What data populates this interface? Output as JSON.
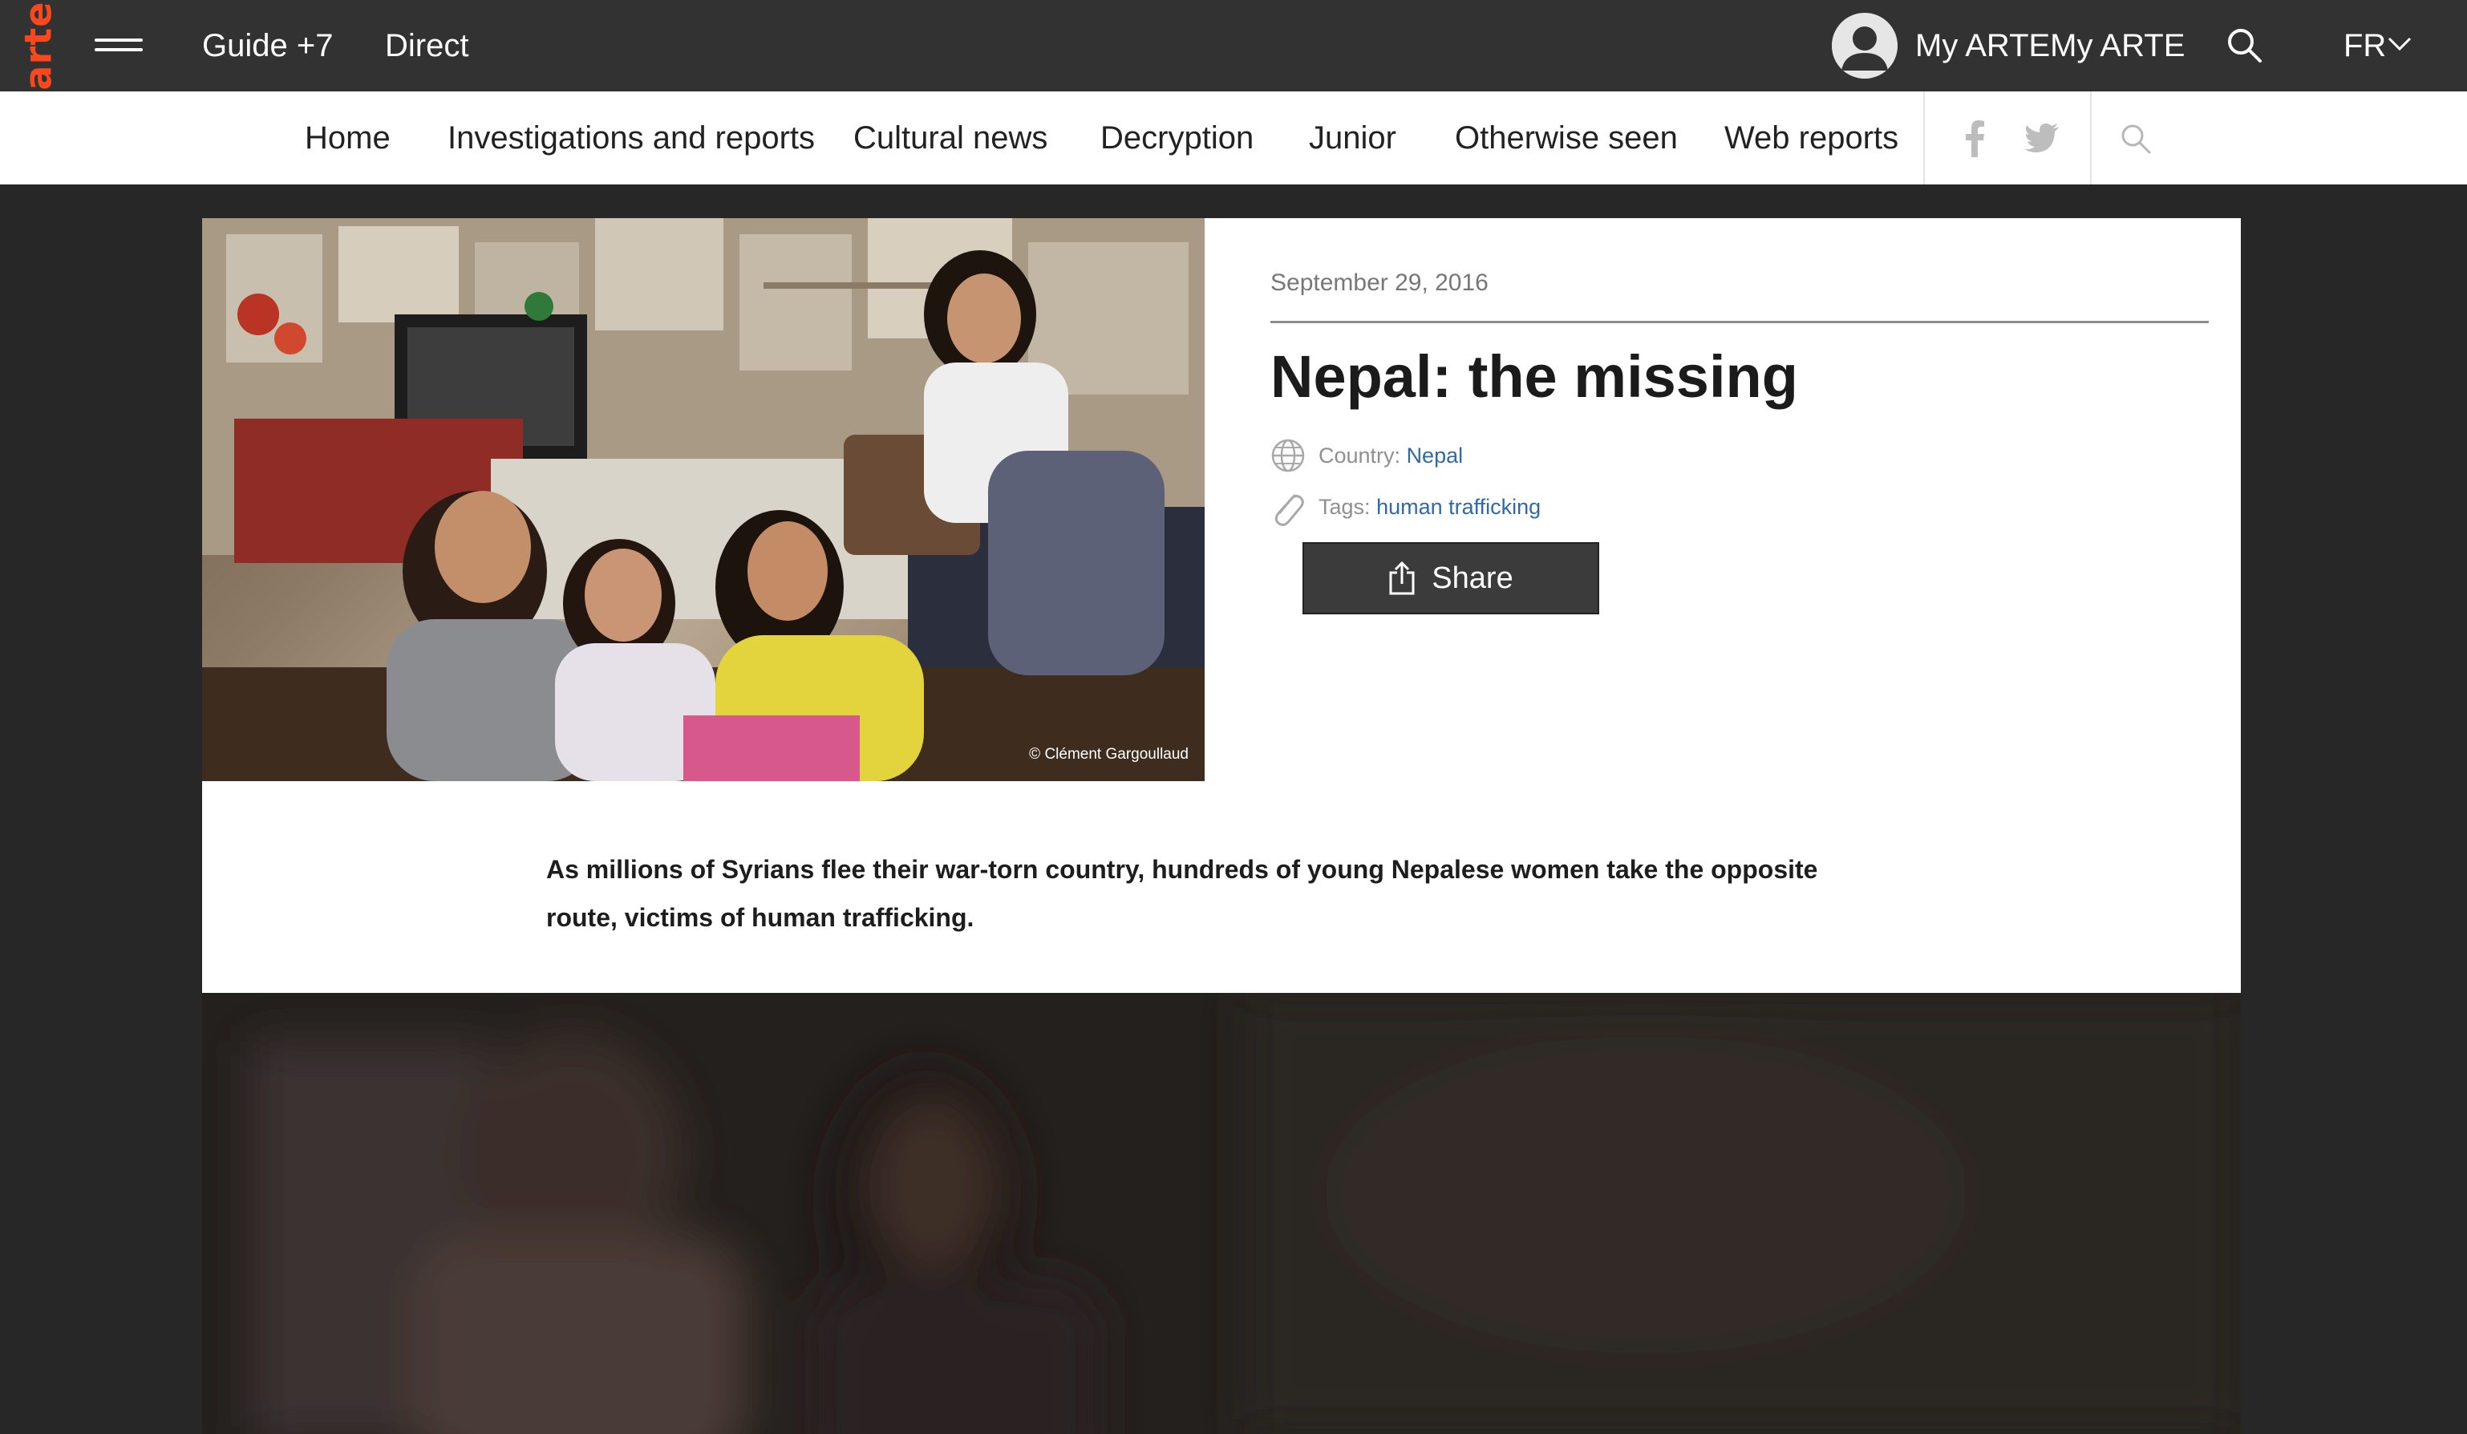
{
  "topbar": {
    "logo": "arte",
    "guide_label": "Guide +7",
    "direct_label": "Direct",
    "myarte_label": "My ARTEMy ARTE",
    "lang_label": "FR"
  },
  "nav": {
    "items": [
      "Home",
      "Investigations and reports",
      "Cultural news",
      "Decryption",
      "Junior",
      "Otherwise seen",
      "Web reports"
    ]
  },
  "article": {
    "photo_credit": "© Clément Gargoullaud",
    "date": "September 29, 2016",
    "title": "Nepal: the missing",
    "country_label": "Country:",
    "country_value": "Nepal",
    "tags_label": "Tags:",
    "tags_value": "human trafficking",
    "share_label": "Share",
    "lead": "As millions of Syrians flee their war-torn country, hundreds of young Nepalese women take the opposite route, victims of human trafficking."
  },
  "colors": {
    "brand": "#fa481c",
    "topbar": "#323232",
    "link": "#2e6aa8",
    "share_button": "#3b3b3b"
  }
}
